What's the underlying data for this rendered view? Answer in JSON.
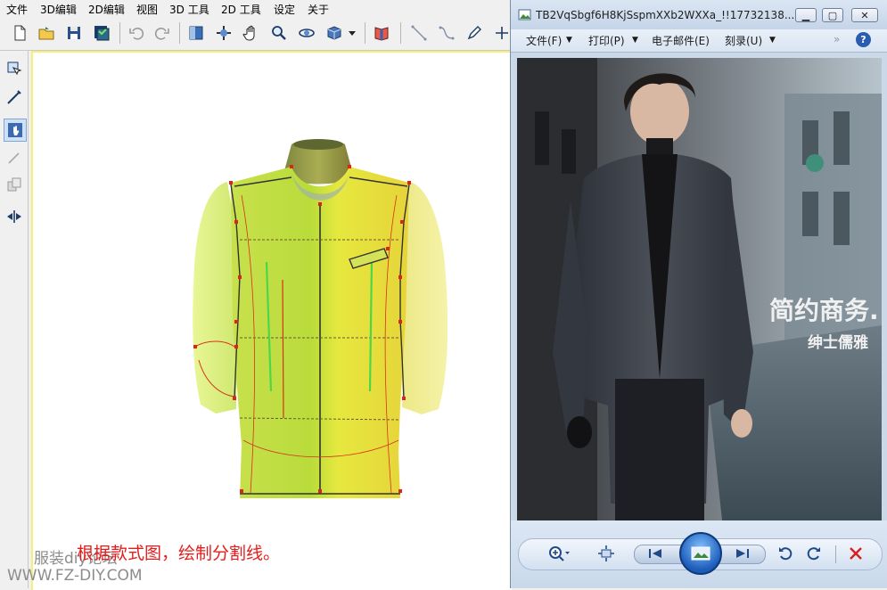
{
  "cad_app": {
    "menu": [
      "文件",
      "3D编辑",
      "2D编辑",
      "视图",
      "3D 工具",
      "2D 工具",
      "设定",
      "关于"
    ],
    "toolbar_icons": [
      "new-file-icon",
      "open-folder-icon",
      "save-icon",
      "save-all-icon",
      "undo-icon",
      "redo-icon",
      "split-view-icon",
      "rotate-view-icon",
      "hand-pan-icon",
      "zoom-icon",
      "orbit-icon",
      "render-mode-icon",
      "dropdown-arrow-icon",
      "texture-icon",
      "line-tool-icon",
      "curve-tool-icon",
      "pen-tool-icon",
      "point-tool-icon"
    ],
    "side_tools": [
      "select-piece-icon",
      "draw-line-icon",
      "hand-select-icon",
      "pointer-icon",
      "piece-layer-icon",
      "mirror-icon"
    ],
    "annotation": "根据款式图，绘制分割线。",
    "watermark_line1": "服装diy论坛",
    "watermark_line2": "WWW.FZ-DIY.COM",
    "accent_color": "#f6ef7a",
    "annotation_color": "#e51c1c"
  },
  "viewer": {
    "title": "TB2VqSbgf6H8KjSspmXXb2WXXa_!!17732138...",
    "menu": [
      {
        "label": "文件(F)",
        "has_dropdown": true
      },
      {
        "label": "打印(P)",
        "has_dropdown": true
      },
      {
        "label": "电子邮件(E)",
        "has_dropdown": false
      },
      {
        "label": "刻录(U)",
        "has_dropdown": true
      }
    ],
    "photo_text_1": "简约商务.",
    "photo_text_2": "绅士儒雅",
    "controls": [
      "zoom-icon",
      "fit-window-icon",
      "previous-icon",
      "slideshow-icon",
      "next-icon",
      "rotate-ccw-icon",
      "rotate-cw-icon",
      "delete-icon"
    ]
  }
}
